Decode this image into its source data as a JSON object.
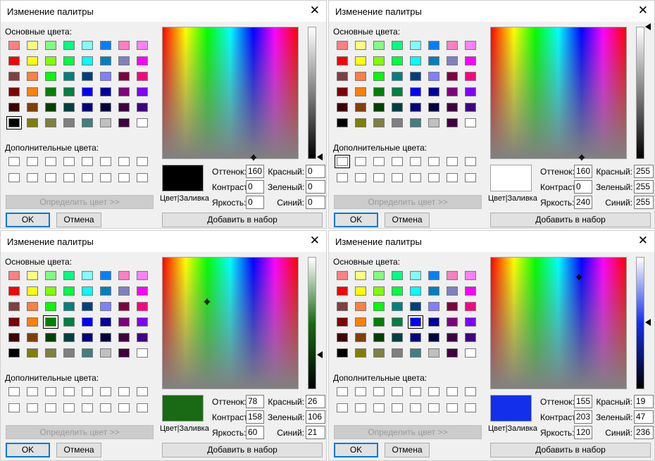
{
  "basic_colors": [
    "#ff8080",
    "#ffff80",
    "#80ff80",
    "#00ff80",
    "#80ffff",
    "#0080ff",
    "#ff80c0",
    "#ff80ff",
    "#ff0000",
    "#ffff00",
    "#80ff00",
    "#00ff40",
    "#00ffff",
    "#0080c0",
    "#8080c0",
    "#ff00ff",
    "#804040",
    "#ff8040",
    "#00ff00",
    "#008080",
    "#004080",
    "#8080ff",
    "#800040",
    "#ff0080",
    "#800000",
    "#ff8000",
    "#008000",
    "#008040",
    "#0000ff",
    "#0000a0",
    "#800080",
    "#8000ff",
    "#400000",
    "#804000",
    "#004000",
    "#004040",
    "#000080",
    "#000040",
    "#400040",
    "#400080",
    "#000000",
    "#808000",
    "#808040",
    "#808080",
    "#408080",
    "#c0c0c0",
    "#400040",
    "#ffffff"
  ],
  "dialogs": [
    {
      "title": "Изменение палитры",
      "basic_label": "Основные цвета:",
      "custom_label": "Дополнительные цвета:",
      "define_button": "Определить цвет >>",
      "ok_button": "OK",
      "cancel_button": "Отмена",
      "add_button": "Добавить в набор",
      "preview_label": "Цвет|Заливка",
      "labels": {
        "hue": "Оттенок:",
        "sat": "Контраст:",
        "lum": "Яркость:",
        "red": "Красный:",
        "green": "Зеленый:",
        "blue": "Синий:"
      },
      "values": {
        "hue": "160",
        "sat": "0",
        "lum": "0",
        "red": "0",
        "green": "0",
        "blue": "0"
      },
      "current_color": "#000000",
      "selected_basic_index": 40,
      "selected_custom_index": -1,
      "hue_value": 160,
      "sat_value": 0,
      "lum_value": 0
    },
    {
      "title": "Изменение палитры",
      "basic_label": "Основные цвета:",
      "custom_label": "Дополнительные цвета:",
      "define_button": "Определить цвет >>",
      "ok_button": "OK",
      "cancel_button": "Отмена",
      "add_button": "Добавить в набор",
      "preview_label": "Цвет|Заливка",
      "labels": {
        "hue": "Оттенок:",
        "sat": "Контраст:",
        "lum": "Яркость:",
        "red": "Красный:",
        "green": "Зеленый:",
        "blue": "Синий:"
      },
      "values": {
        "hue": "160",
        "sat": "0",
        "lum": "240",
        "red": "255",
        "green": "255",
        "blue": "255"
      },
      "current_color": "#ffffff",
      "selected_basic_index": -1,
      "selected_custom_index": 0,
      "hue_value": 160,
      "sat_value": 0,
      "lum_value": 240
    },
    {
      "title": "Изменение палитры",
      "basic_label": "Основные цвета:",
      "custom_label": "Дополнительные цвета:",
      "define_button": "Определить цвет >>",
      "ok_button": "OK",
      "cancel_button": "Отмена",
      "add_button": "Добавить в набор",
      "preview_label": "Цвет|Заливка",
      "labels": {
        "hue": "Оттенок:",
        "sat": "Контраст:",
        "lum": "Яркость:",
        "red": "Красный:",
        "green": "Зеленый:",
        "blue": "Синий:"
      },
      "values": {
        "hue": "78",
        "sat": "158",
        "lum": "60",
        "red": "26",
        "green": "106",
        "blue": "21"
      },
      "current_color": "#1a6a15",
      "selected_basic_index": 26,
      "selected_custom_index": -1,
      "hue_value": 78,
      "sat_value": 158,
      "lum_value": 60
    },
    {
      "title": "Изменение палитры",
      "basic_label": "Основные цвета:",
      "custom_label": "Дополнительные цвета:",
      "define_button": "Определить цвет >>",
      "ok_button": "OK",
      "cancel_button": "Отмена",
      "add_button": "Добавить в набор",
      "preview_label": "Цвет|Заливка",
      "labels": {
        "hue": "Оттенок:",
        "sat": "Контраст:",
        "lum": "Яркость:",
        "red": "Красный:",
        "green": "Зеленый:",
        "blue": "Синий:"
      },
      "values": {
        "hue": "155",
        "sat": "203",
        "lum": "120",
        "red": "19",
        "green": "47",
        "blue": "236"
      },
      "current_color": "#132fec",
      "selected_basic_index": 28,
      "selected_custom_index": -1,
      "hue_value": 155,
      "sat_value": 203,
      "lum_value": 120
    }
  ]
}
